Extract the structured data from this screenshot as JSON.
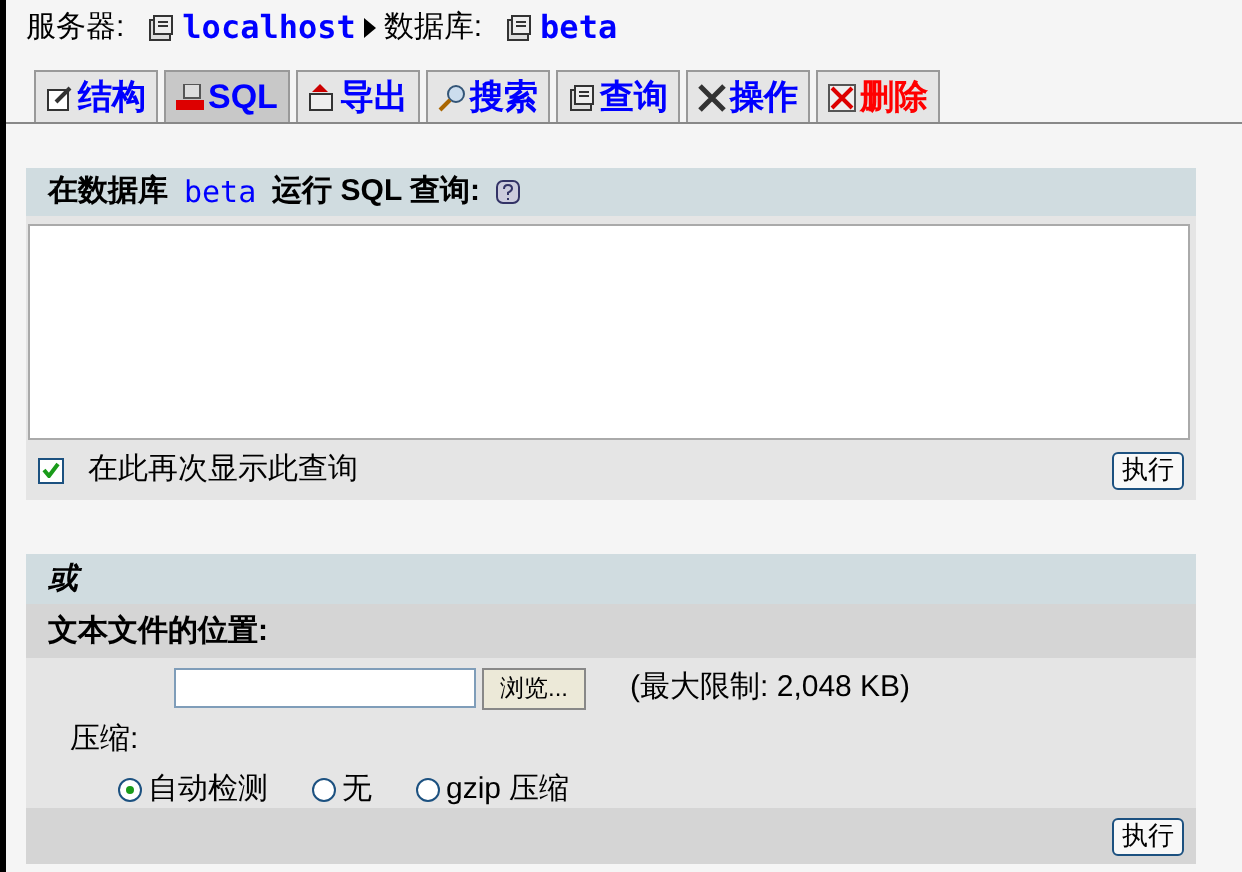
{
  "breadcrumb": {
    "server_label": "服务器:",
    "server": "localhost",
    "database_label": "数据库:",
    "database": "beta"
  },
  "tabs": [
    {
      "label": "结构",
      "selected": false,
      "kind": "normal"
    },
    {
      "label": "SQL",
      "selected": true,
      "kind": "normal"
    },
    {
      "label": "导出",
      "selected": false,
      "kind": "normal"
    },
    {
      "label": "搜索",
      "selected": false,
      "kind": "normal"
    },
    {
      "label": "查询",
      "selected": false,
      "kind": "normal"
    },
    {
      "label": "操作",
      "selected": false,
      "kind": "normal"
    },
    {
      "label": "删除",
      "selected": false,
      "kind": "danger"
    }
  ],
  "query_panel": {
    "title_before": "在数据库",
    "database": "beta",
    "title_after": "运行 SQL 查询:",
    "show_again": {
      "label": "在此再次显示此查询",
      "checked": true
    },
    "submit": "执行"
  },
  "file_panel": {
    "or_label": "或",
    "location_label": "文本文件的位置:",
    "browse": "浏览...",
    "max_size": "(最大限制: 2,048 KB)",
    "compression_label": "压缩:",
    "compression_options": [
      {
        "label": "自动检测",
        "selected": true
      },
      {
        "label": "无",
        "selected": false
      },
      {
        "label": "gzip 压缩",
        "selected": false
      }
    ],
    "submit": "执行"
  }
}
